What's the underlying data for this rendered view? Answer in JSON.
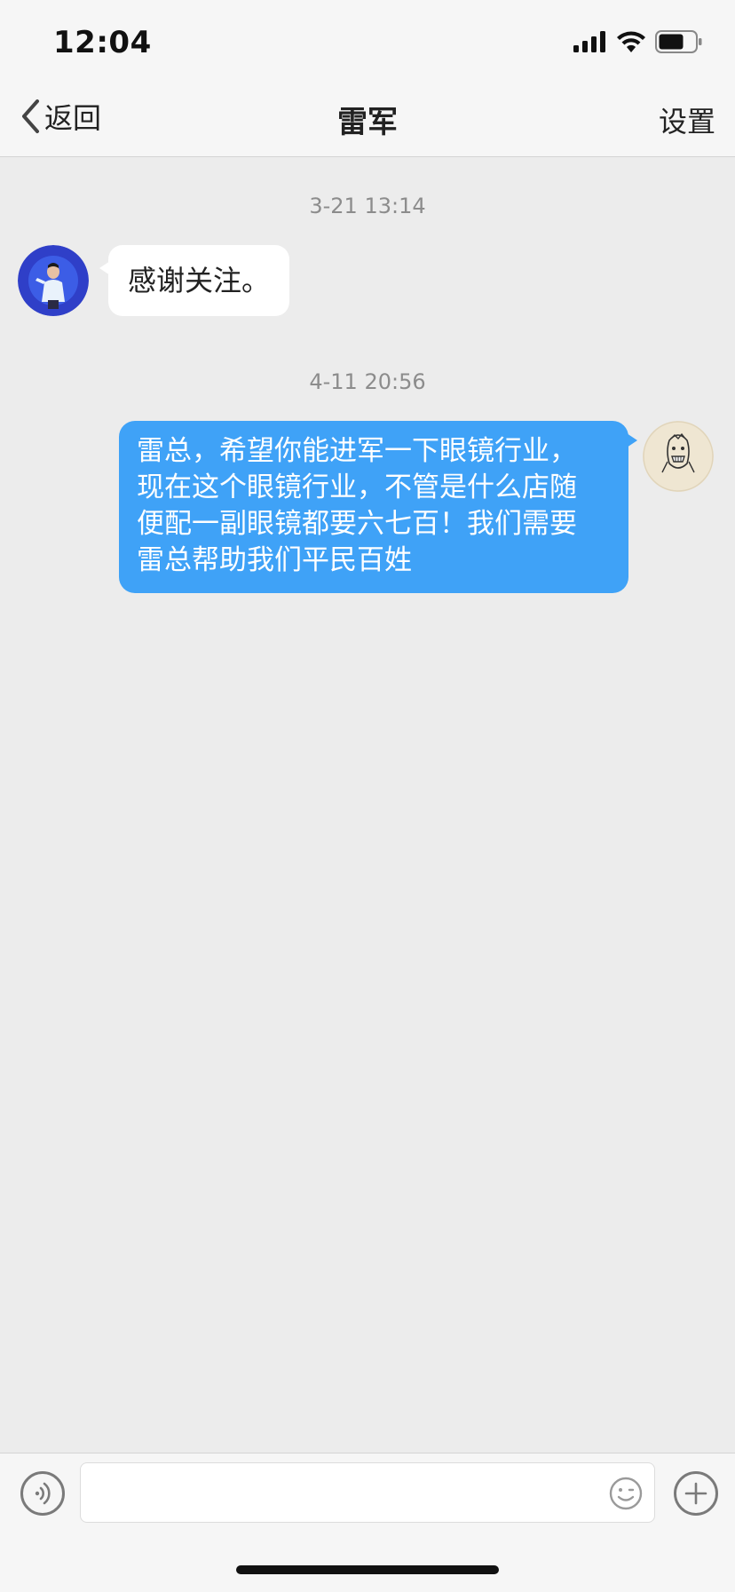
{
  "status_bar": {
    "time": "12:04",
    "icons": [
      "signal-icon",
      "wifi-icon",
      "battery-icon"
    ]
  },
  "nav": {
    "back_label": "返回",
    "title": "雷军",
    "settings_label": "设置"
  },
  "chat": {
    "messages": [
      {
        "timestamp": "3-21 13:14",
        "direction": "incoming",
        "text": "感谢关注。"
      },
      {
        "timestamp": "4-11 20:56",
        "direction": "outgoing",
        "lines": [
          "雷总，希望你能进军一下眼镜行业，",
          "现在这个眼镜行业，不管是什么店随",
          "便配一副眼镜都要六七百！我们需要",
          "雷总帮助我们平民百姓"
        ]
      }
    ]
  },
  "input_bar": {
    "icons": [
      "voice-icon",
      "emoji-icon",
      "add-icon"
    ]
  },
  "colors": {
    "outgoing_bubble": "#3fa2f7",
    "incoming_bubble": "#ffffff",
    "chat_background": "#ececec",
    "bar_background": "#f6f6f6"
  }
}
